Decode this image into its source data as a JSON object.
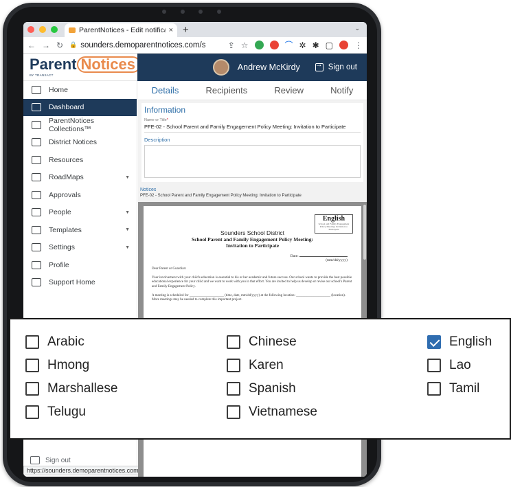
{
  "browser": {
    "tab_title": "ParentNotices - Edit notificatio",
    "tab_close": "×",
    "new_tab": "+",
    "url": "sounders.demoparentnotices.com/s",
    "status_url": "https://sounders.demoparentnotices.com"
  },
  "header": {
    "logo_parent": "Parent",
    "logo_notices": "Notices",
    "logo_sub": "BY TRANSACT",
    "user_name": "Andrew McKirdy",
    "sign_out": "Sign out"
  },
  "sidebar": {
    "items": [
      {
        "label": "Home",
        "icon": "home-icon",
        "active": false,
        "caret": false
      },
      {
        "label": "Dashboard",
        "icon": "dashboard-icon",
        "active": true,
        "caret": false
      },
      {
        "label": "ParentNotices Collections™",
        "icon": "folder-icon",
        "active": false,
        "caret": false
      },
      {
        "label": "District Notices",
        "icon": "building-icon",
        "active": false,
        "caret": false
      },
      {
        "label": "Resources",
        "icon": "book-icon",
        "active": false,
        "caret": false
      },
      {
        "label": "RoadMaps",
        "icon": "roadmap-icon",
        "active": false,
        "caret": true
      },
      {
        "label": "Approvals",
        "icon": "approvals-icon",
        "active": false,
        "caret": false
      },
      {
        "label": "People",
        "icon": "people-icon",
        "active": false,
        "caret": true
      },
      {
        "label": "Templates",
        "icon": "template-icon",
        "active": false,
        "caret": true
      },
      {
        "label": "Settings",
        "icon": "gear-icon",
        "active": false,
        "caret": true
      },
      {
        "label": "Profile",
        "icon": "profile-icon",
        "active": false,
        "caret": false
      },
      {
        "label": "Support Home",
        "icon": "help-icon",
        "active": false,
        "caret": false
      }
    ],
    "sign_out": "Sign out"
  },
  "main": {
    "tabs": [
      {
        "label": "Details",
        "active": true
      },
      {
        "label": "Recipients",
        "active": false
      },
      {
        "label": "Review",
        "active": false
      },
      {
        "label": "Notify",
        "active": false
      }
    ],
    "information_title": "Information",
    "name_label": "Name or Title",
    "name_required": "*",
    "name_value": "PFE-02 - School Parent and Family Engagement Policy Meeting: Invitation to Participate",
    "description_label": "Description",
    "notices_label": "Notices",
    "notices_value": "PFE-02 - School Parent and Family Engagement Policy Meeting: Invitation to Participate"
  },
  "document": {
    "badge_language": "English",
    "badge_sub": "School and Family Engagement Policy Meeting: Invitation to Participate",
    "district": "Sounders School District",
    "heading1": "School Parent and Family Engagement Policy Meeting:",
    "heading2": "Invitation to Participate",
    "date_label": "Date:",
    "date_hint": "(mm/dd/yyyy)",
    "greeting": "Dear Parent or Guardian:",
    "para1": "Your involvement with your child's education is essential to his or her academic and future success. Our school wants to provide the best possible educational experience for your child and we want to work with you in that effort. You are invited to help us develop or revise our school's Parent and Family Engagement Policy.",
    "para2": "A meeting is scheduled for ____________________ (time, date, mm/dd/yyyy) at the following location: ____________________ (location). More meetings may be needed to complete this important project."
  },
  "languages": [
    {
      "label": "Arabic",
      "checked": false
    },
    {
      "label": "Chinese",
      "checked": false
    },
    {
      "label": "English",
      "checked": true
    },
    {
      "label": "Hmong",
      "checked": false
    },
    {
      "label": "Karen",
      "checked": false
    },
    {
      "label": "Lao",
      "checked": false
    },
    {
      "label": "Marshallese",
      "checked": false
    },
    {
      "label": "Spanish",
      "checked": false
    },
    {
      "label": "Tamil",
      "checked": false
    },
    {
      "label": "Telugu",
      "checked": false
    },
    {
      "label": "Vietnamese",
      "checked": false
    }
  ],
  "colors": {
    "nav_dark": "#1e3a5a",
    "accent_blue": "#2f6fa8",
    "logo_orange": "#e98a4c",
    "checkbox_checked": "#2f6db0"
  }
}
